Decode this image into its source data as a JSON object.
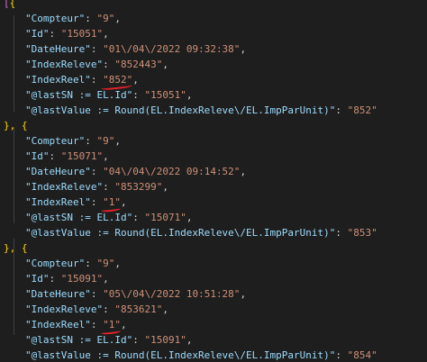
{
  "editor": {
    "punct": {
      "open_first": "[{",
      "separator": "}, {",
      "comma": ",",
      "colon": ": "
    },
    "records": [
      {
        "Compteur": "\"9\"",
        "Id": "\"15051\"",
        "DateHeure": "\"01\\/04\\/2022 09:32:38\"",
        "IndexReleve": "\"852443\"",
        "IndexReel": "\"852\"",
        "lastSN": "\"15051\"",
        "lastValue": "\"852\""
      },
      {
        "Compteur": "\"9\"",
        "Id": "\"15071\"",
        "DateHeure": "\"04\\/04\\/2022 09:14:52\"",
        "IndexReleve": "\"853299\"",
        "IndexReel": "\"1\"",
        "lastSN": "\"15071\"",
        "lastValue": "\"853\""
      },
      {
        "Compteur": "\"9\"",
        "Id": "\"15091\"",
        "DateHeure": "\"05\\/04\\/2022 10:51:28\"",
        "IndexReleve": "\"853621\"",
        "IndexReel": "\"1\"",
        "lastSN": "\"15091\"",
        "lastValue": "\"854\""
      }
    ],
    "keys": {
      "Compteur": "\"Compteur\"",
      "Id": "\"Id\"",
      "DateHeure": "\"DateHeure\"",
      "IndexReleve": "\"IndexReleve\"",
      "IndexReel": "\"IndexReel\"",
      "lastSN": "\"@lastSN := EL.Id\"",
      "lastValue": "\"@lastValue := Round(EL.IndexReleve\\/EL.ImpParUnit)\""
    },
    "colors": {
      "background": "#1e1e1e",
      "key": "#9cdcfe",
      "string": "#ce9178",
      "brace": "#ffd700",
      "bracket": "#da70d6",
      "annotation": "#e8222b"
    }
  }
}
